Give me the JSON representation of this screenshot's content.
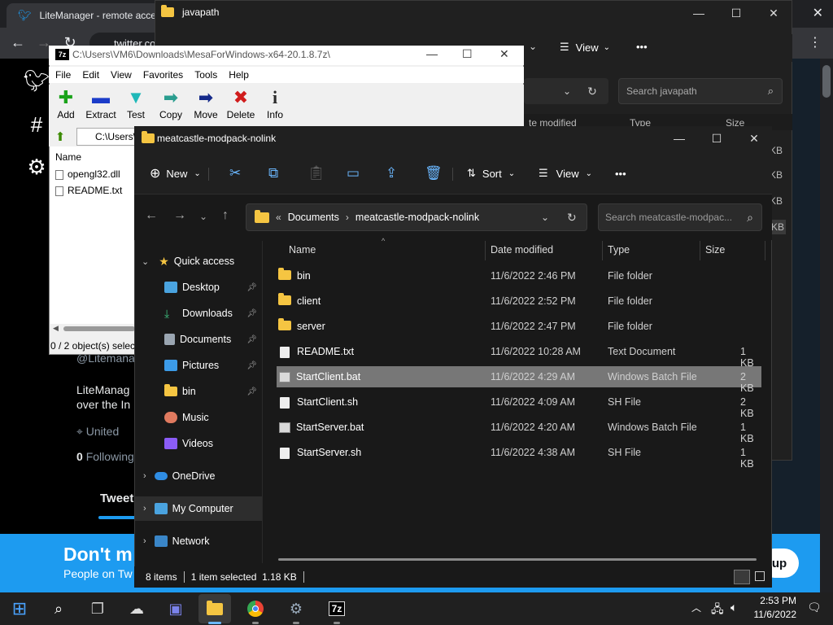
{
  "browser": {
    "tab_title": "LiteManager - remote access",
    "url": "twitter.com",
    "twitter": {
      "profile_handle": "@Litemanager",
      "name_line1": "LiteManag",
      "name_line2": "over the In",
      "location": "United",
      "following_count": "0",
      "following_label": "Following",
      "tweets_tab": "Tweet",
      "banner_title": "Don't m",
      "banner_sub": "People on Tw",
      "signup_label": "up",
      "tag_icon": "#"
    }
  },
  "javapath": {
    "title": "javapath",
    "view_label": "View",
    "more_label": "•••",
    "search_placeholder": "Search javapath",
    "col_modified": "te modified",
    "col_type": "Type",
    "col_size": "Size",
    "size_kb": "KB",
    "sizes": [
      "KB",
      "KB",
      "KB",
      "KB"
    ]
  },
  "sevenzip": {
    "logo": "7z",
    "title": "C:\\Users\\VM6\\Downloads\\MesaForWindows-x64-20.1.8.7z\\",
    "menu": [
      "File",
      "Edit",
      "View",
      "Favorites",
      "Tools",
      "Help"
    ],
    "tools": [
      {
        "label": "Add",
        "glyph": "✚",
        "color": "#1aa31a"
      },
      {
        "label": "Extract",
        "glyph": "▬",
        "color": "#1b3cc9"
      },
      {
        "label": "Test",
        "glyph": "▼",
        "color": "#1fb8b8"
      },
      {
        "label": "Copy",
        "glyph": "➡",
        "color": "#2a9d8f"
      },
      {
        "label": "Move",
        "glyph": "➡",
        "color": "#152a8a"
      },
      {
        "label": "Delete",
        "glyph": "✖",
        "color": "#d01c1c"
      },
      {
        "label": "Info",
        "glyph": "i",
        "color": "#2b2b2b"
      }
    ],
    "path_short": "C:\\Users\\",
    "column_name": "Name",
    "files": [
      "opengl32.dll",
      "README.txt"
    ],
    "status": "0 / 2 object(s) selec"
  },
  "explorer": {
    "title": "meatcastle-modpack-nolink",
    "commands": {
      "new": "New",
      "sort": "Sort",
      "view": "View",
      "more": "•••"
    },
    "breadcrumb": {
      "prefix": "«",
      "parent": "Documents",
      "sep": "›",
      "current": "meatcastle-modpack-nolink"
    },
    "search_placeholder": "Search meatcastle-modpac...",
    "nav": {
      "quick_access": "Quick access",
      "desktop": "Desktop",
      "downloads": "Downloads",
      "documents": "Documents",
      "pictures": "Pictures",
      "bin": "bin",
      "music": "Music",
      "videos": "Videos",
      "onedrive": "OneDrive",
      "my_computer": "My Computer",
      "network": "Network"
    },
    "columns": {
      "name": "Name",
      "date": "Date modified",
      "type": "Type",
      "size": "Size"
    },
    "files": [
      {
        "name": "bin",
        "date": "11/6/2022 2:46 PM",
        "type": "File folder",
        "size": "",
        "kind": "folder"
      },
      {
        "name": "client",
        "date": "11/6/2022 2:52 PM",
        "type": "File folder",
        "size": "",
        "kind": "folder"
      },
      {
        "name": "server",
        "date": "11/6/2022 2:47 PM",
        "type": "File folder",
        "size": "",
        "kind": "folder"
      },
      {
        "name": "README.txt",
        "date": "11/6/2022 10:28 AM",
        "type": "Text Document",
        "size": "1 KB",
        "kind": "txt"
      },
      {
        "name": "StartClient.bat",
        "date": "11/6/2022 4:29 AM",
        "type": "Windows Batch File",
        "size": "2 KB",
        "kind": "bat",
        "selected": true
      },
      {
        "name": "StartClient.sh",
        "date": "11/6/2022 4:09 AM",
        "type": "SH File",
        "size": "2 KB",
        "kind": "file"
      },
      {
        "name": "StartServer.bat",
        "date": "11/6/2022 4:20 AM",
        "type": "Windows Batch File",
        "size": "1 KB",
        "kind": "bat"
      },
      {
        "name": "StartServer.sh",
        "date": "11/6/2022 4:38 AM",
        "type": "SH File",
        "size": "1 KB",
        "kind": "file"
      }
    ],
    "status": {
      "items": "8 items",
      "selected": "1 item selected  1.18 KB"
    }
  },
  "taskbar": {
    "time": "2:53 PM",
    "date": "11/6/2022",
    "sz_label": "7z"
  }
}
